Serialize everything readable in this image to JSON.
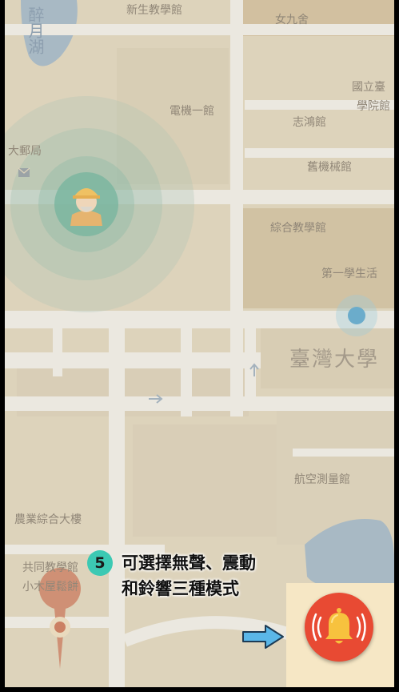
{
  "map": {
    "labels": {
      "xinsheng": "新生教學館",
      "nv9": "女九舍",
      "ntu_top": "國立臺",
      "xueyuan": "學院館",
      "dianji": "電機一館",
      "zhihong": "志鴻館",
      "post": "大郵局",
      "jixie": "舊機械館",
      "zonghe": "綜合教學館",
      "first_student": "第一學生活",
      "ntu_big": "臺灣大學",
      "hangkong": "航空測量館",
      "nongye": "農業綜合大樓",
      "gongtong": "共同教學館",
      "xiaomu": "小木屋鬆餅",
      "lake": "醉月湖"
    }
  },
  "tutorial": {
    "step": "5",
    "line1": "可選擇無聲、震動",
    "line2": "和鈴響三種模式"
  },
  "alarm": {
    "icon": "bell-ringing-icon",
    "color": "#e84a33"
  },
  "icons": {
    "worker": "worker-avatar-icon",
    "mail": "mail-icon",
    "location": "location-pin-icon",
    "my_location": "my-location-dot-icon",
    "arrow": "arrow-right-icon"
  }
}
